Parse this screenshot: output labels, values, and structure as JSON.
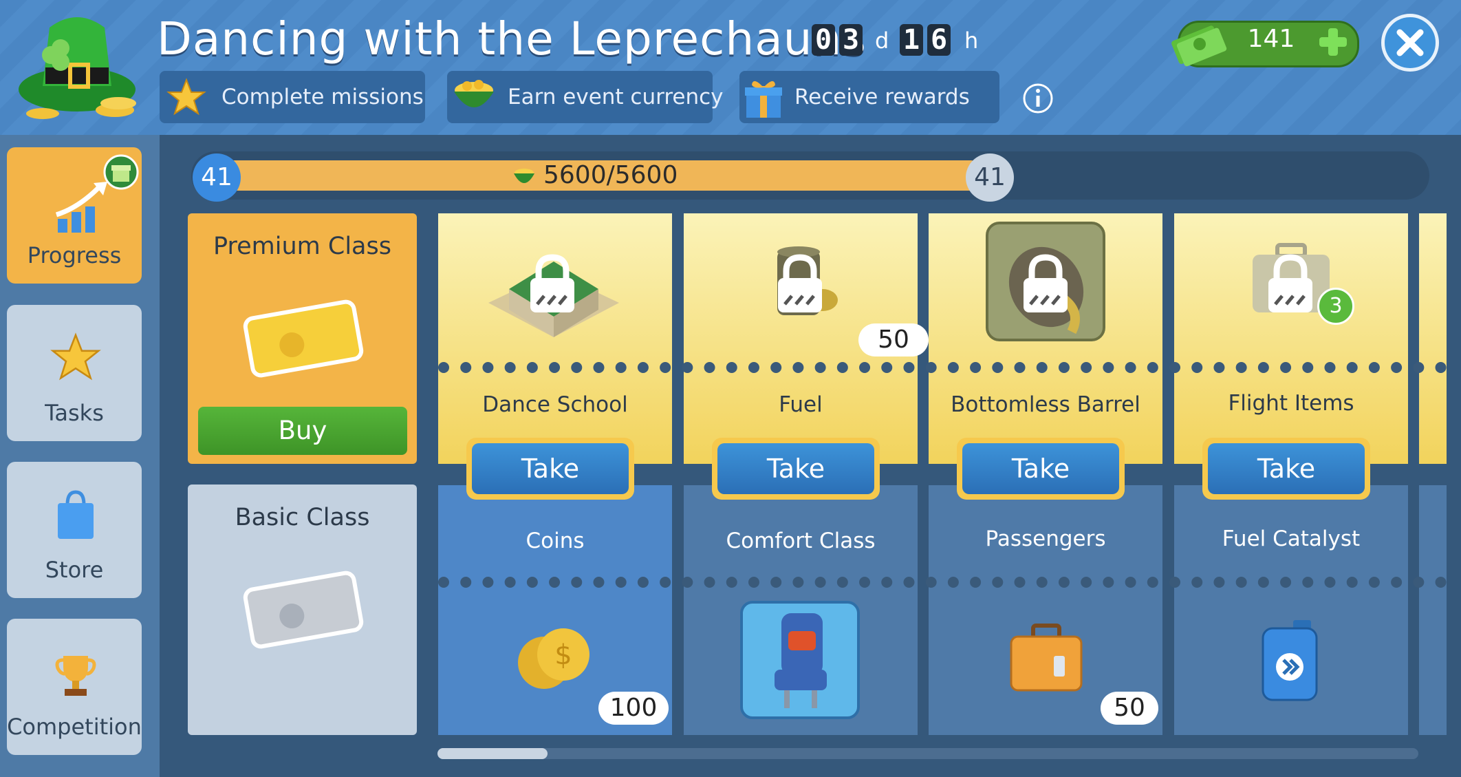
{
  "header": {
    "title": "Dancing with the Leprechauns",
    "timer": {
      "d1": "0",
      "d2": "3",
      "d_unit": "d",
      "h1": "1",
      "h2": "6",
      "h_unit": "h"
    },
    "steps": [
      "Complete missions",
      "Earn event currency",
      "Receive rewards"
    ],
    "currency_amount": "141"
  },
  "sidebar": {
    "items": [
      {
        "label": "Progress",
        "active": true
      },
      {
        "label": "Tasks",
        "active": false
      },
      {
        "label": "Store",
        "active": false
      },
      {
        "label": "Competition",
        "active": false
      }
    ]
  },
  "progress": {
    "level_current": "41",
    "level_next": "41",
    "text": "5600/5600",
    "fraction": 1.0
  },
  "classes": {
    "premium": {
      "title": "Premium Class",
      "buy_label": "Buy"
    },
    "basic": {
      "title": "Basic Class"
    }
  },
  "rewards": [
    {
      "premium_name": "Dance School",
      "premium_badge": "",
      "take_label": "Take",
      "basic_name": "Coins",
      "basic_badge": "100"
    },
    {
      "premium_name": "Fuel",
      "premium_badge": "50",
      "take_label": "Take",
      "basic_name": "Comfort Class",
      "basic_badge": ""
    },
    {
      "premium_name": "Bottomless Barrel",
      "premium_badge": "",
      "take_label": "Take",
      "basic_name": "Passengers",
      "basic_badge": "50"
    },
    {
      "premium_name": "Flight Items",
      "premium_badge": "",
      "take_label": "Take",
      "basic_name": "Fuel Catalyst",
      "basic_badge": ""
    }
  ],
  "flight_items_count": "3",
  "colors": {
    "accent": "#f3b448",
    "header": "#4a86c4",
    "take_button": "#2b6fb6",
    "money": "#4c9a2f"
  }
}
